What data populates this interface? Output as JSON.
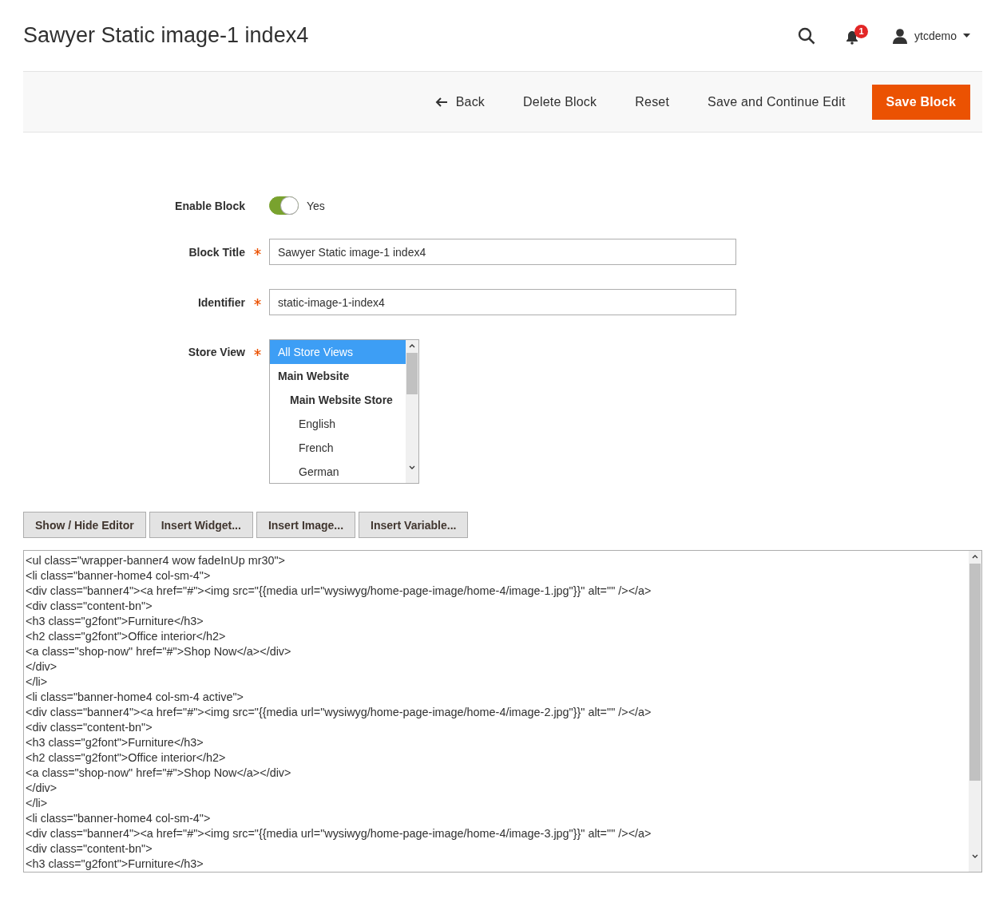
{
  "page_title": "Sawyer Static image-1 index4",
  "header": {
    "notifications_count": "1",
    "user": "ytcdemo"
  },
  "actions": [
    {
      "label": "Back",
      "kind": "back"
    },
    {
      "label": "Delete Block",
      "kind": "plain"
    },
    {
      "label": "Reset",
      "kind": "plain"
    },
    {
      "label": "Save and Continue Edit",
      "kind": "plain"
    },
    {
      "label": "Save Block",
      "kind": "primary"
    }
  ],
  "form": {
    "enable_block": {
      "label": "Enable Block",
      "on": true,
      "value_label": "Yes"
    },
    "fields": [
      {
        "label": "Block Title",
        "required": true,
        "value": "Sawyer Static image-1 index4"
      },
      {
        "label": "Identifier",
        "required": true,
        "value": "static-image-1-index4"
      }
    ],
    "store_view": {
      "label": "Store View",
      "required": true,
      "options": [
        {
          "label": "All Store Views",
          "kind": "option",
          "selected": true
        },
        {
          "label": "Main Website",
          "kind": "website",
          "selected": false
        },
        {
          "label": "Main Website Store",
          "kind": "store",
          "selected": false
        },
        {
          "label": "English",
          "kind": "view",
          "selected": false
        },
        {
          "label": "French",
          "kind": "view",
          "selected": false
        },
        {
          "label": "German",
          "kind": "view",
          "selected": false
        }
      ]
    }
  },
  "editor_buttons": [
    "Show / Hide Editor",
    "Insert Widget...",
    "Insert Image...",
    "Insert Variable..."
  ],
  "editor": {
    "lines": [
      "<ul class=\"wrapper-banner4 wow fadeInUp mr30\">",
      "<li class=\"banner-home4 col-sm-4\">",
      "<div class=\"banner4\"><a href=\"#\"><img src=\"{{media url=\"wysiwyg/home-page-image/home-4/image-1.jpg\"}}\" alt=\"\" /></a>",
      "<div class=\"content-bn\">",
      "<h3 class=\"g2font\">Furniture</h3>",
      "<h2 class=\"g2font\">Office interior</h2>",
      "<a class=\"shop-now\" href=\"#\">Shop Now</a></div>",
      "</div>",
      "</li>",
      "<li class=\"banner-home4 col-sm-4 active\">",
      "<div class=\"banner4\"><a href=\"#\"><img src=\"{{media url=\"wysiwyg/home-page-image/home-4/image-2.jpg\"}}\" alt=\"\" /></a>",
      "<div class=\"content-bn\">",
      "<h3 class=\"g2font\">Furniture</h3>",
      "<h2 class=\"g2font\">Office interior</h2>",
      "<a class=\"shop-now\" href=\"#\">Shop Now</a></div>",
      "</div>",
      "</li>",
      "<li class=\"banner-home4 col-sm-4\">",
      "<div class=\"banner4\"><a href=\"#\"><img src=\"{{media url=\"wysiwyg/home-page-image/home-4/image-3.jpg\"}}\" alt=\"\" /></a>",
      "<div class=\"content-bn\">",
      "<h3 class=\"g2font\">Furniture</h3>"
    ]
  }
}
